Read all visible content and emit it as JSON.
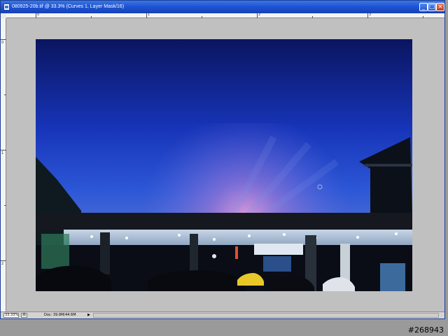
{
  "window": {
    "title": "080925-20b.tif @ 33.3% (Curves 1, Layer Mask/16)",
    "controls": {
      "minimize": "_",
      "maximize": "□",
      "close": "×"
    }
  },
  "rulers": {
    "top_labels": [
      "0",
      "1",
      "2",
      "3"
    ],
    "left_labels": [
      "0",
      "1",
      "2"
    ]
  },
  "status": {
    "zoom": "33.33%",
    "doc_info": "Doc: 39.8M/44.6M",
    "arrow": "▶"
  },
  "watermark": "#268943",
  "colors": {
    "title_bar": "#1f55d4",
    "pasteboard": "#c0c0c0",
    "sky_top": "#0a1560",
    "sky_mid": "#2c57d6",
    "horizon_glow": "#e0a0d8"
  },
  "icons": {
    "document": "document-icon",
    "cursor": "brush-cursor-icon"
  }
}
